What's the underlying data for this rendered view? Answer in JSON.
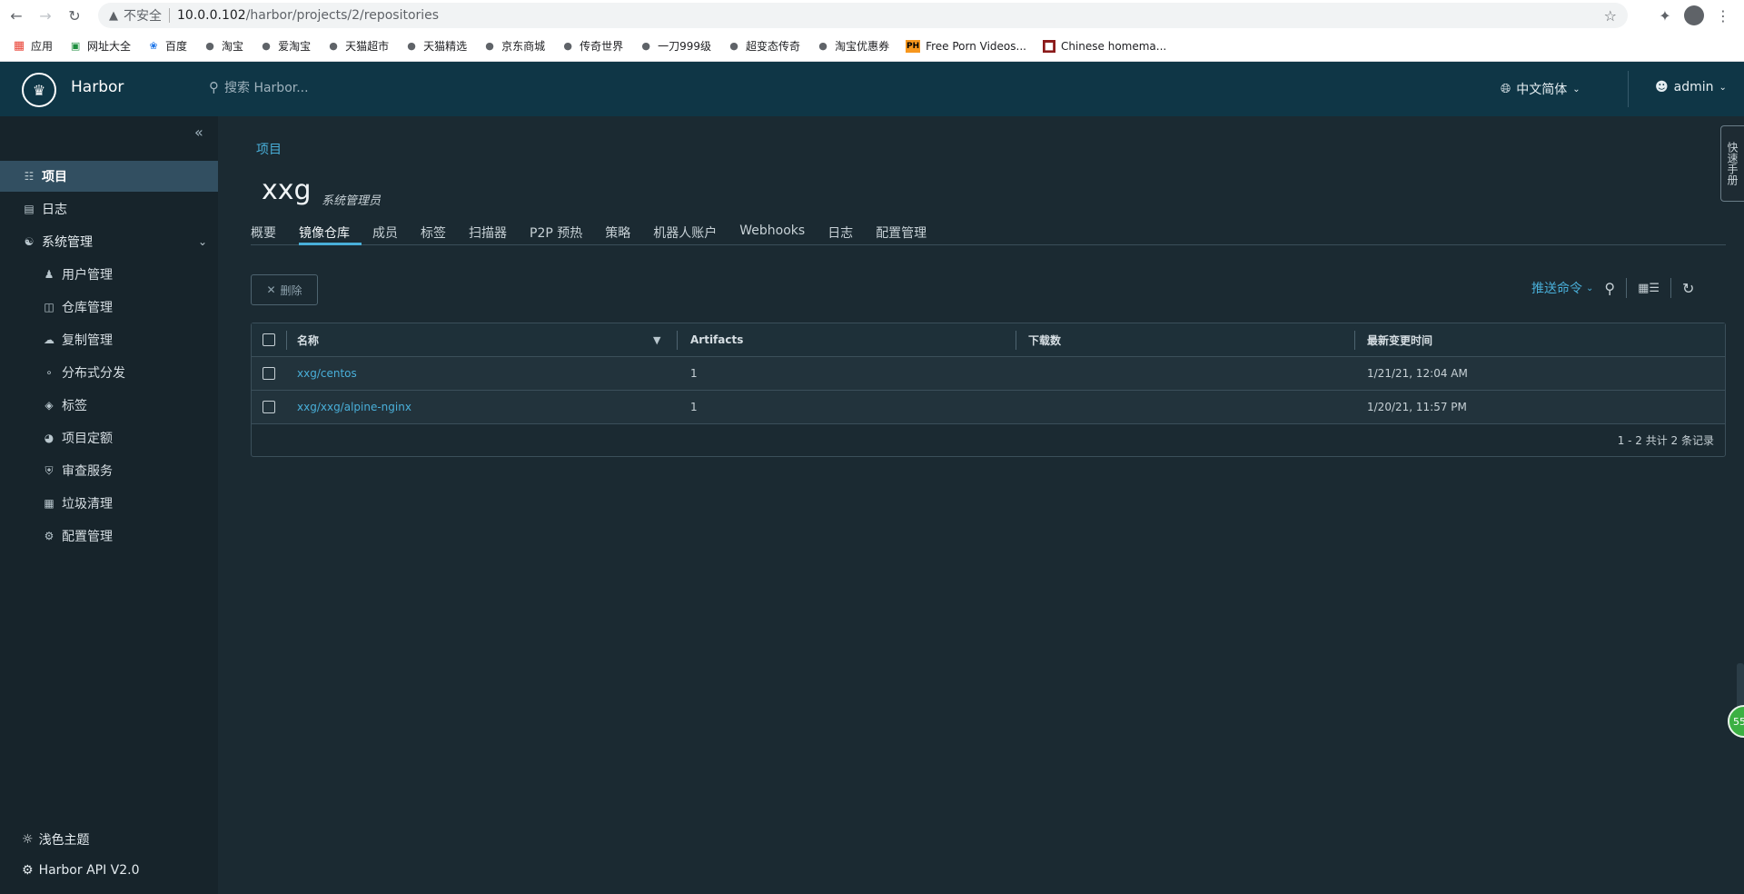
{
  "browser": {
    "insecure_label": "不安全",
    "url_host": "10.0.0.102",
    "url_path": "/harbor/projects/2/repositories"
  },
  "bookmarks": [
    {
      "label": "应用",
      "icon": "apps-grid-icon"
    },
    {
      "label": "网址大全",
      "icon": "bookmark-icon"
    },
    {
      "label": "百度",
      "icon": "paw-icon"
    },
    {
      "label": "淘宝",
      "icon": "globe-icon"
    },
    {
      "label": "爱淘宝",
      "icon": "globe-icon"
    },
    {
      "label": "天猫超市",
      "icon": "globe-icon"
    },
    {
      "label": "天猫精选",
      "icon": "globe-icon"
    },
    {
      "label": "京东商城",
      "icon": "globe-icon"
    },
    {
      "label": "传奇世界",
      "icon": "globe-icon"
    },
    {
      "label": "一刀999级",
      "icon": "globe-icon"
    },
    {
      "label": "超变态传奇",
      "icon": "globe-icon"
    },
    {
      "label": "淘宝优惠券",
      "icon": "globe-icon"
    },
    {
      "label": "Free Porn Videos...",
      "icon": "ph-icon",
      "badge": "PH"
    },
    {
      "label": "Chinese homema...",
      "icon": "site-icon"
    }
  ],
  "header": {
    "brand": "Harbor",
    "search_placeholder": "搜索 Harbor...",
    "language": "中文简体",
    "user": "admin"
  },
  "sidebar": {
    "items": [
      {
        "label": "项目",
        "active": true,
        "icon": "project-icon"
      },
      {
        "label": "日志",
        "icon": "log-icon"
      },
      {
        "label": "系统管理",
        "icon": "admin-icon",
        "expanded": true
      }
    ],
    "sub_items": [
      {
        "label": "用户管理",
        "icon": "users-icon"
      },
      {
        "label": "仓库管理",
        "icon": "cube-icon"
      },
      {
        "label": "复制管理",
        "icon": "cloud-icon"
      },
      {
        "label": "分布式分发",
        "icon": "share-icon"
      },
      {
        "label": "标签",
        "icon": "tag-icon"
      },
      {
        "label": "项目定额",
        "icon": "quota-icon"
      },
      {
        "label": "审查服务",
        "icon": "shield-icon"
      },
      {
        "label": "垃圾清理",
        "icon": "trash-icon"
      },
      {
        "label": "配置管理",
        "icon": "gear-icon"
      }
    ],
    "footer": {
      "theme": "浅色主题",
      "api": "Harbor API V2.0"
    }
  },
  "main": {
    "breadcrumb": "项目",
    "project_name": "xxg",
    "project_role": "系统管理员",
    "tabs": [
      {
        "label": "概要"
      },
      {
        "label": "镜像仓库",
        "active": true
      },
      {
        "label": "成员"
      },
      {
        "label": "标签"
      },
      {
        "label": "扫描器"
      },
      {
        "label": "P2P 预热"
      },
      {
        "label": "策略"
      },
      {
        "label": "机器人账户"
      },
      {
        "label": "Webhooks"
      },
      {
        "label": "日志"
      },
      {
        "label": "配置管理"
      }
    ],
    "delete_label": "删除",
    "push_command_label": "推送命令",
    "table": {
      "columns": [
        "名称",
        "Artifacts",
        "下载数",
        "最新变更时间"
      ],
      "rows": [
        {
          "name": "xxg/centos",
          "artifacts": "1",
          "downloads": "",
          "updated": "1/21/21, 12:04 AM"
        },
        {
          "name": "xxg/xxg/alpine-nginx",
          "artifacts": "1",
          "downloads": "",
          "updated": "1/20/21, 11:57 PM"
        }
      ],
      "footer": "1 - 2 共计 2 条记录"
    }
  },
  "widgets": {
    "feedback_tab": "快速手册",
    "badge_value": "55"
  }
}
